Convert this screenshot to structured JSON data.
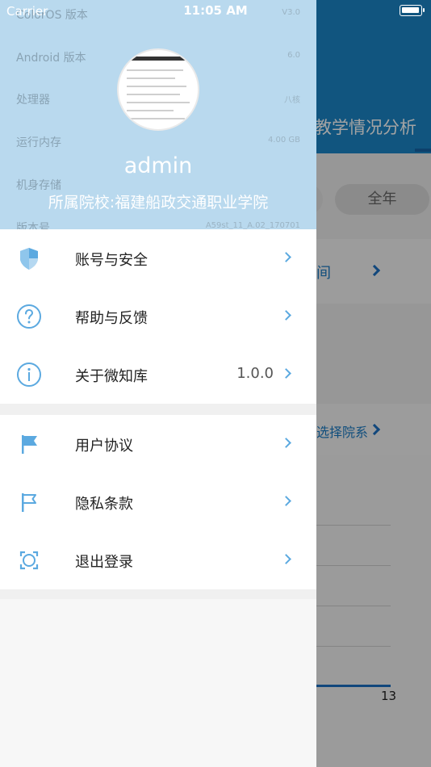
{
  "status_bar": {
    "carrier": "Carrier",
    "time": "11:05 AM"
  },
  "background": {
    "title": "教学情况分析",
    "period_selected": "全年",
    "card1_text": "间",
    "card2_text": "选择院系",
    "chart_tick": "13"
  },
  "drawer": {
    "profile_specs": [
      {
        "label": "ColorOS 版本",
        "value": "V3.0"
      },
      {
        "label": "Android 版本",
        "value": "6.0"
      },
      {
        "label": "处理器",
        "value": "八核"
      },
      {
        "label": "运行内存",
        "value": "4.00 GB"
      },
      {
        "label": "机身存储",
        "value": ""
      },
      {
        "label": "版本号",
        "value": "A59st_11_A.02_170701"
      }
    ],
    "username": "admin",
    "school": "所属院校:福建船政交通职业学院",
    "menu_group_1": [
      {
        "label": "账号与安全",
        "icon": "shield-icon"
      },
      {
        "label": "帮助与反馈",
        "icon": "help-circle-icon"
      },
      {
        "label": "关于微知库",
        "icon": "info-circle-icon",
        "value": "1.0.0"
      }
    ],
    "menu_group_2": [
      {
        "label": "用户协议",
        "icon": "flag-filled-icon"
      },
      {
        "label": "隐私条款",
        "icon": "flag-outline-icon"
      },
      {
        "label": "退出登录",
        "icon": "logout-icon"
      }
    ],
    "accent_color": "#5ba9e0"
  }
}
